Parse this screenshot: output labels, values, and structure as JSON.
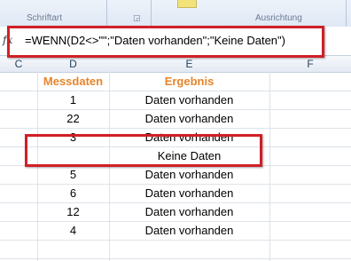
{
  "ribbon": {
    "group_font": "Schriftart",
    "group_align": "Ausrichtung"
  },
  "formula_bar": {
    "fx_icon": "fx",
    "formula": "=WENN(D2<>\"\";\"Daten vorhanden\";\"Keine Daten\")"
  },
  "columns": [
    "C",
    "D",
    "E",
    "F"
  ],
  "table": {
    "headers": [
      "Messdaten",
      "Ergebnis"
    ],
    "rows": [
      [
        "1",
        "Daten vorhanden"
      ],
      [
        "22",
        "Daten vorhanden"
      ],
      [
        "3",
        "Daten vorhanden"
      ],
      [
        "",
        "Keine Daten"
      ],
      [
        "5",
        "Daten vorhanden"
      ],
      [
        "6",
        "Daten vorhanden"
      ],
      [
        "12",
        "Daten vorhanden"
      ],
      [
        "4",
        "Daten vorhanden"
      ]
    ]
  },
  "colors": {
    "header_text": "#e8852a",
    "highlight": "#d11f26"
  }
}
